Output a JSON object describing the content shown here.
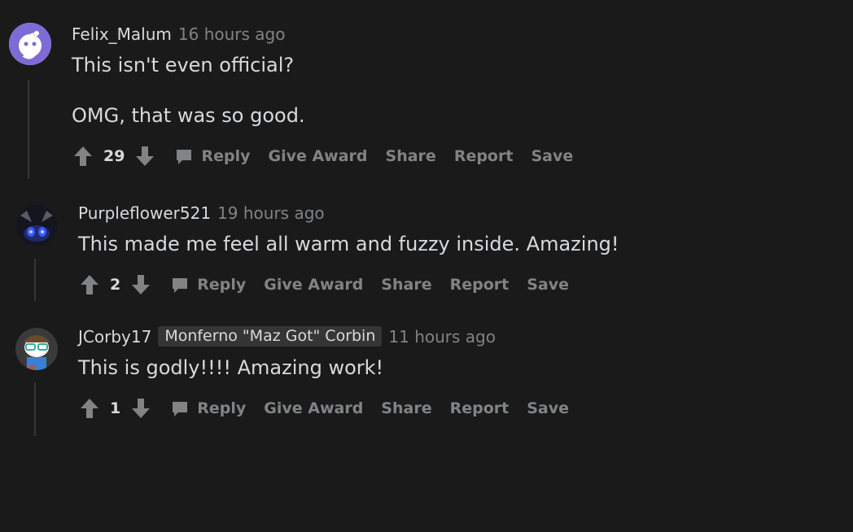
{
  "comments": [
    {
      "author": "Felix_Malum",
      "time": "16 hours ago",
      "paragraphs": [
        "This isn't even official?",
        "OMG, that was so good."
      ],
      "score": "29",
      "avatar": "snoo-thinking-avatar"
    },
    {
      "author": "Purpleflower521",
      "time": "19 hours ago",
      "paragraphs": [
        "This made me feel all warm and fuzzy inside. Amazing!"
      ],
      "score": "2",
      "avatar": "dark-creature-avatar"
    },
    {
      "author": "JCorby17",
      "flair": "Monferno \"Maz Got\" Corbin",
      "time": "11 hours ago",
      "paragraphs": [
        "This is godly!!!! Amazing work!"
      ],
      "score": "1",
      "avatar": "snoo-glasses-avatar"
    }
  ],
  "actions": {
    "reply": "Reply",
    "give_award": "Give Award",
    "share": "Share",
    "report": "Report",
    "save": "Save"
  },
  "colors": {
    "background": "#1a1a1b",
    "text": "#d7dadc",
    "muted": "#818384",
    "thread_line": "#343536"
  }
}
